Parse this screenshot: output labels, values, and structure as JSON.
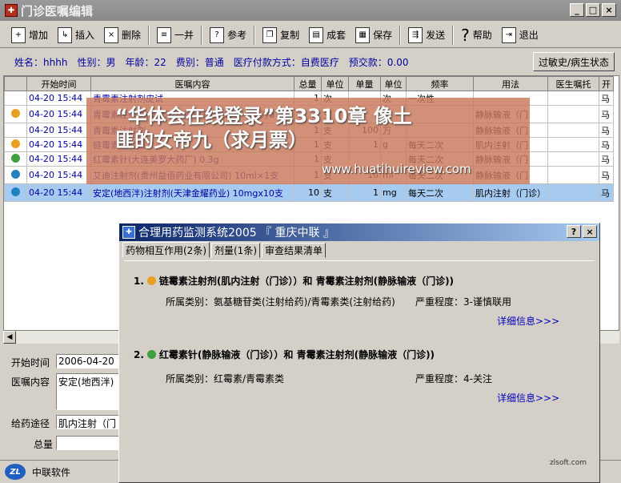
{
  "window": {
    "title": "门诊医嘱编辑",
    "minimize": "_",
    "maximize": "□",
    "close": "×"
  },
  "toolbar": [
    {
      "label": "增加",
      "icon": "add-doc-icon"
    },
    {
      "label": "插入",
      "icon": "insert-doc-icon"
    },
    {
      "label": "删除",
      "icon": "delete-doc-icon"
    },
    {
      "label": "一并",
      "icon": "merge-doc-icon"
    },
    {
      "label": "参考",
      "icon": "reference-icon"
    },
    {
      "label": "复制",
      "icon": "copy-icon"
    },
    {
      "label": "成套",
      "icon": "set-icon"
    },
    {
      "label": "保存",
      "icon": "save-icon"
    },
    {
      "label": "发送",
      "icon": "send-icon"
    },
    {
      "label": "帮助",
      "icon": "help-icon"
    },
    {
      "label": "退出",
      "icon": "exit-icon"
    }
  ],
  "patient": {
    "name": "姓名：hhhh",
    "gender": "性别：男",
    "age": "年龄：22",
    "fee": "费别：普通",
    "payment": "医疗付款方式：自费医疗",
    "prepay": "预交款：0.00",
    "allergy_button": "过敏史/病生状态"
  },
  "grid": {
    "columns": [
      "",
      "开始时间",
      "医嘱内容",
      "总量",
      "单位",
      "单量",
      "单位",
      "频率",
      "用法",
      "医生嘱托",
      "开"
    ],
    "rows": [
      {
        "dot": "",
        "time": "04-20 15:44",
        "content": "青霉素注射剂皮试",
        "total": "1",
        "unit": "次",
        "dose": "",
        "dunit": "次",
        "freq": "一次性",
        "usage": "",
        "note": "",
        "doc": "马"
      },
      {
        "dot": "#e8a020",
        "time": "04-20 15:44",
        "content": "青霉素注射剂(华北制药股份有限公司) 400万u",
        "total": "1",
        "unit": "支",
        "dose": "",
        "dunit": "",
        "freq": "",
        "usage": "静脉输液（门",
        "note": "",
        "doc": "马"
      },
      {
        "dot": "",
        "time": "04-20 15:44",
        "content": "青霉素注射剂",
        "total": "1",
        "unit": "支",
        "dose": "100",
        "dunit": "万",
        "freq": "",
        "usage": "静脉输液（门",
        "note": "",
        "doc": "马"
      },
      {
        "dot": "#e8a020",
        "time": "04-20 15:44",
        "content": "链霉素注射剂",
        "total": "1",
        "unit": "支",
        "dose": "1",
        "dunit": "g",
        "freq": "每天二次",
        "usage": "肌内注射（门",
        "note": "",
        "doc": "马"
      },
      {
        "dot": "#40a040",
        "time": "04-20 15:44",
        "content": "红霉素针(大连美罗大药厂) 0.3g",
        "total": "1",
        "unit": "支",
        "dose": "",
        "dunit": "",
        "freq": "每天二次",
        "usage": "静脉输液（门",
        "note": "",
        "doc": "马"
      },
      {
        "dot": "#2080c0",
        "time": "04-20 15:44",
        "content": "艾迪注射剂(贵州益佰药业有限公司) 10ml×1支",
        "total": "1",
        "unit": "支",
        "dose": "10",
        "dunit": "ml",
        "freq": "每天二次",
        "usage": "静脉输液（门",
        "note": "",
        "doc": "马"
      },
      {
        "dot": "#2080c0",
        "time": "04-20 15:44",
        "content": "安定(地西泮)注射剂(天津金耀药业) 10mgx10支",
        "total": "10",
        "unit": "支",
        "dose": "1",
        "dunit": "mg",
        "freq": "每天二次",
        "usage": "肌内注射（门诊）",
        "note": "",
        "doc": "马"
      }
    ]
  },
  "form": {
    "start_label": "开始时间",
    "start_value": "2006-04-20 1",
    "content_label": "医嘱内容",
    "content_value": "安定(地西泮)",
    "route_label": "给药途径",
    "route_value": "肌内注射（门",
    "total_label": "总量",
    "total_value": ""
  },
  "status": {
    "company": "中联软件",
    "logo": "ZL"
  },
  "watermark": {
    "line1": "“华体会在线登录”第3310章 像土",
    "line2": "匪的女帝九（求月票）",
    "url": "www.huatihuireview.com"
  },
  "dialog": {
    "title": "合理用药监测系统2005 『 重庆中联 』",
    "help": "?",
    "close": "×",
    "tabs": [
      "药物相互作用(2条)",
      "剂量(1条)",
      "审查结果清单"
    ],
    "items": [
      {
        "num": "1.",
        "dot": "#e8a020",
        "title": "链霉素注射剂(肌内注射（门诊））和 青霉素注射剂(静脉输液（门诊))",
        "category": "所属类别：氨基糖苷类(注射给药)/青霉素类(注射给药)",
        "severity": "严重程度：3-谨慎联用",
        "detail": "详细信息>>>"
      },
      {
        "num": "2.",
        "dot": "#40a040",
        "title": "红霉素针(静脉输液（门诊））和 青霉素注射剂(静脉输液（门诊))",
        "category": "所属类别：红霉素/青霉素类",
        "severity": "严重程度：4-关注",
        "detail": "详细信息>>>"
      }
    ],
    "site": "zlsoft.com"
  }
}
